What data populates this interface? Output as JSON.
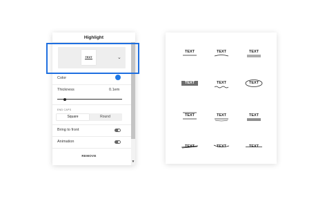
{
  "highlight_panel": {
    "title": "Highlight",
    "preview_text": "TEXT",
    "color_label": "Color",
    "color_value": "#1e78e6",
    "thickness_label": "Thickness",
    "thickness_value": "0.1em",
    "thickness_level": 0.1,
    "end_caps_label": "END CAPS",
    "end_caps_options": [
      "Square",
      "Round"
    ],
    "end_caps_selected": "Square",
    "bring_to_front_label": "Bring to front",
    "animation_label": "Animation",
    "remove_label": "REMOVE",
    "focus_color": "#1e6fe0"
  },
  "style_grid": {
    "items": [
      {
        "text": "TEXT",
        "style": "underline"
      },
      {
        "text": "TEXT",
        "style": "curved-underline"
      },
      {
        "text": "TEXT",
        "style": "double-underline"
      },
      {
        "text": "TEXT",
        "style": "solid-highlight"
      },
      {
        "text": "TEXT",
        "style": "wavy-underline"
      },
      {
        "text": "TEXT",
        "style": "oval-circle"
      },
      {
        "text": "TEXT",
        "style": "overline-underline"
      },
      {
        "text": "TEXT",
        "style": "underline-swoosh"
      },
      {
        "text": "TEXT",
        "style": "thick-double-underline"
      },
      {
        "text": "TEXT",
        "style": "scribble-strike"
      },
      {
        "text": "TEXT",
        "style": "curved-strike"
      },
      {
        "text": "TEXT",
        "style": "strikethrough"
      }
    ]
  }
}
